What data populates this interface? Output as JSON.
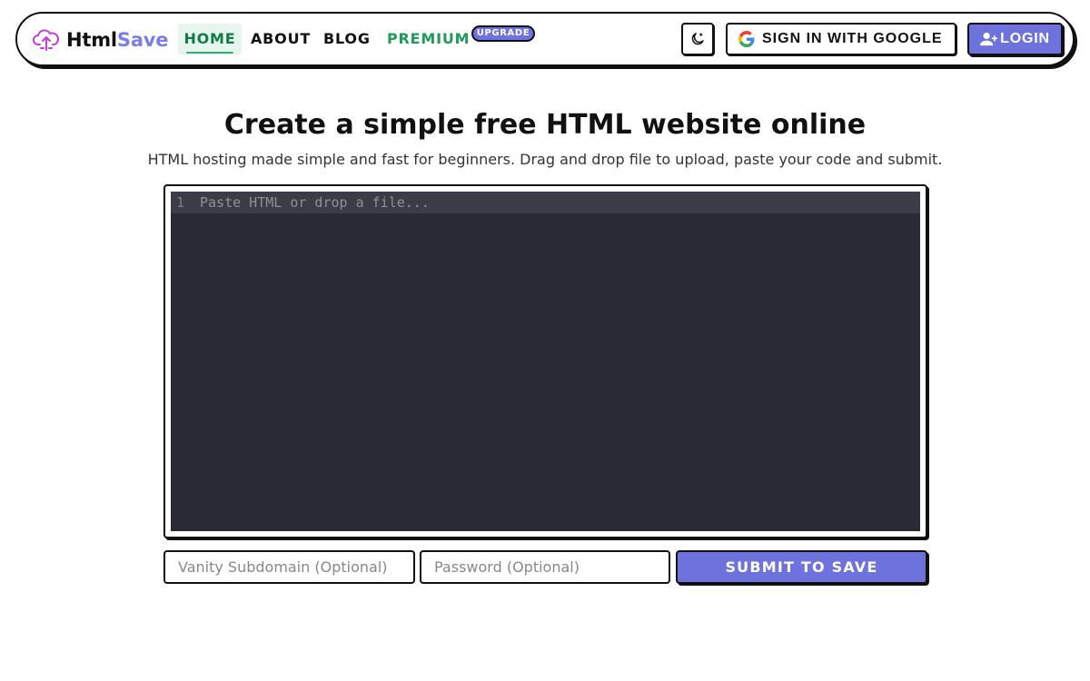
{
  "brand": {
    "name_part1": "Html",
    "name_part2": "Save",
    "logo_icon": "cloud-upload-icon"
  },
  "nav": {
    "items": [
      {
        "label": "HOME",
        "active": true
      },
      {
        "label": "ABOUT"
      },
      {
        "label": "BLOG"
      },
      {
        "label": "PREMIUM"
      }
    ],
    "premium_badge": "UPGRADE",
    "theme_toggle_icon": "moon-icon",
    "google_button": {
      "label": "SIGN IN WITH GOOGLE",
      "icon": "google-icon"
    },
    "login_button": {
      "label": "LOGIN",
      "icon": "user-plus-icon"
    }
  },
  "hero": {
    "title": "Create a simple free HTML website online",
    "subtitle": "HTML hosting made simple and fast for beginners. Drag and drop file to upload, paste your code and submit."
  },
  "editor": {
    "line_number": "1",
    "placeholder": "Paste HTML or drop a file..."
  },
  "form": {
    "subdomain_placeholder": "Vanity Subdomain (Optional)",
    "password_placeholder": "Password (Optional)",
    "submit_label": "SUBMIT TO SAVE"
  },
  "colors": {
    "accent": "#6e72dd",
    "brand_accent": "#7b7fe0",
    "premium_green": "#1f9a5a",
    "home_active_bg": "#e6f6ec",
    "editor_bg": "#282a36"
  }
}
